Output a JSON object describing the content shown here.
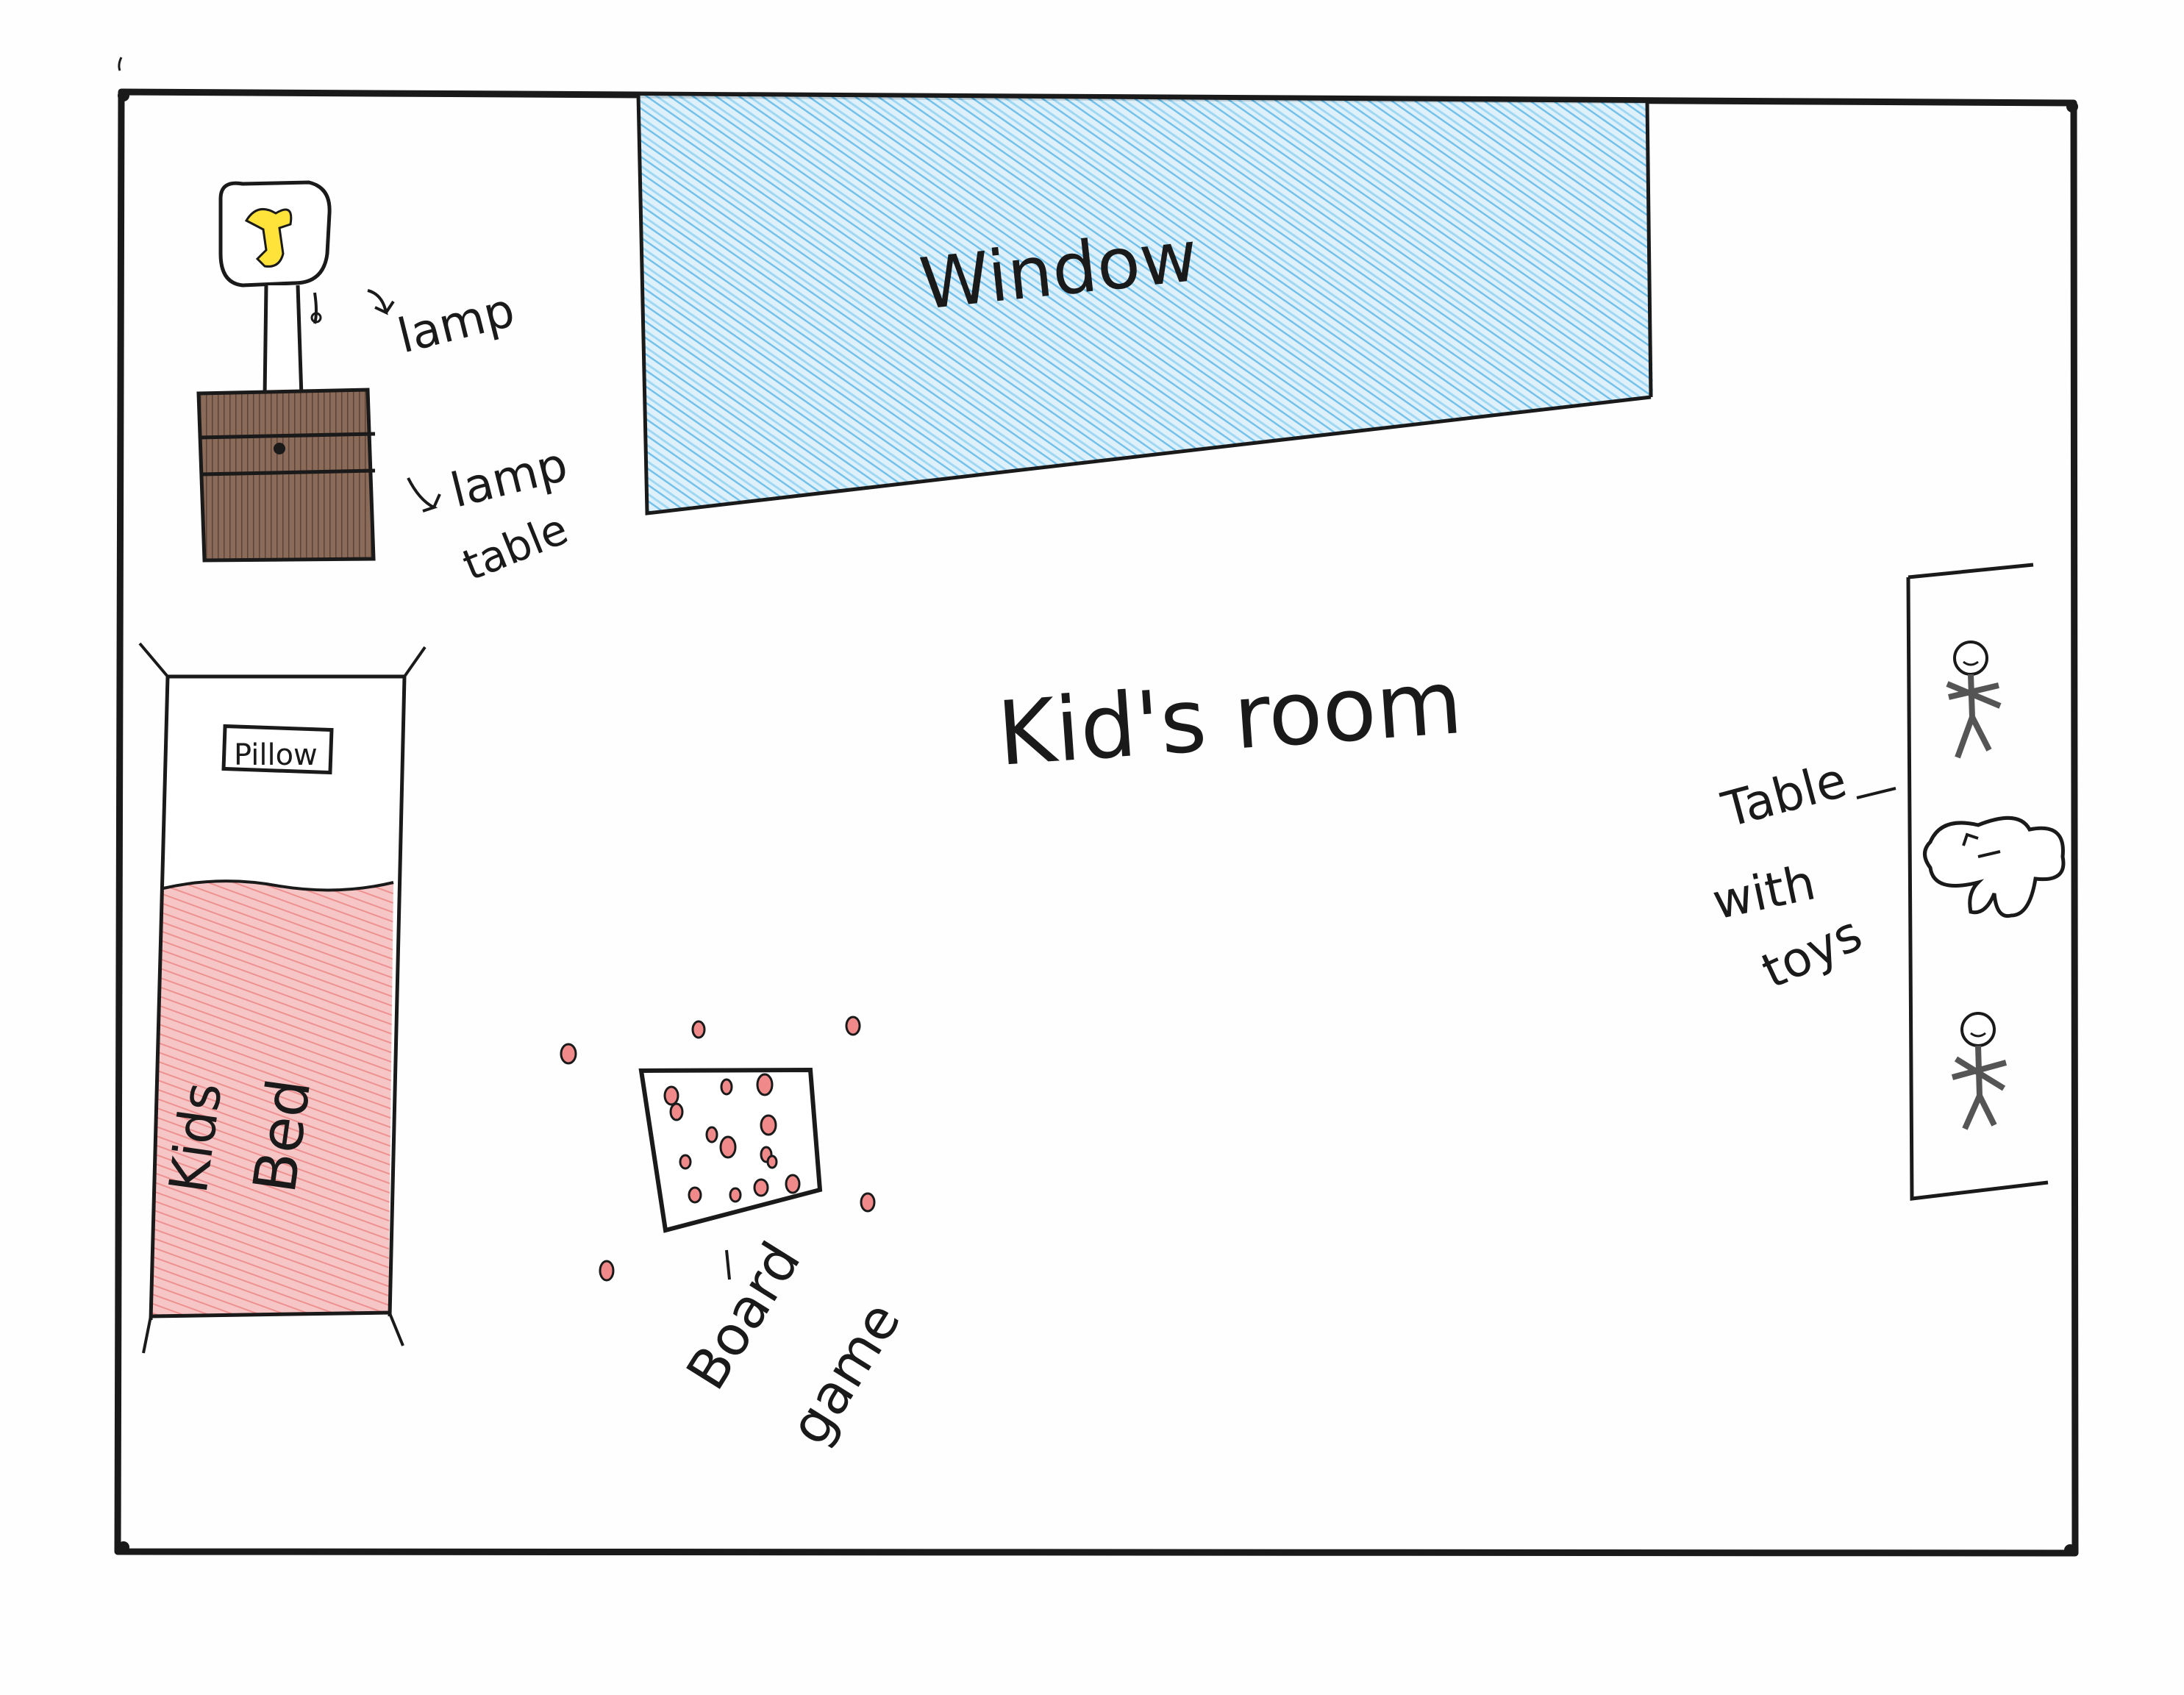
{
  "room": {
    "title": "Kid's room"
  },
  "labels": {
    "window": "Window",
    "lamp": "lamp",
    "lamp_table_line1": "lamp",
    "lamp_table_line2": "table",
    "pillow": "Pillow",
    "bed_line1": "Kids",
    "bed_line2": "Bed",
    "board_line1": "Board",
    "board_line2": "game",
    "toys_line1": "Table",
    "toys_line2": "with",
    "toys_line3": "toys"
  },
  "colors": {
    "ink": "#1a1a1a",
    "window_fill": "#5bb6e6",
    "bed_fill": "#f2a7a7",
    "lamp_table_fill": "#7a5a48",
    "bulb_fill": "#ffe23a",
    "game_piece": "#e04646",
    "toy_scribble": "#555555"
  }
}
